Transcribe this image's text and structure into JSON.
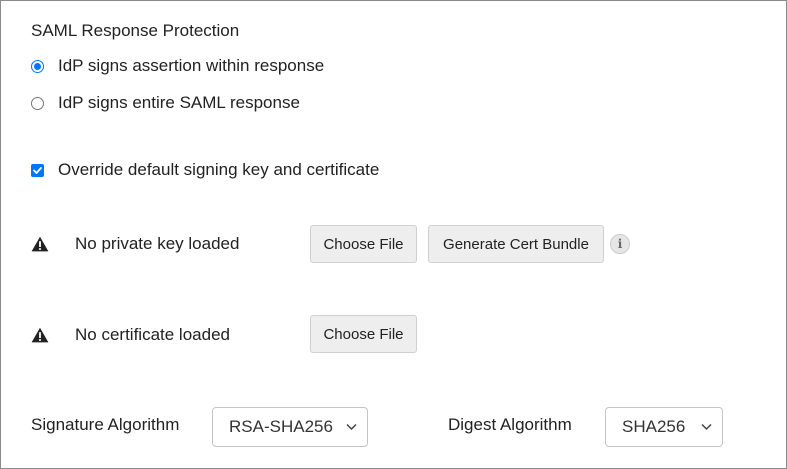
{
  "saml_response_protection": {
    "title": "SAML Response Protection",
    "options": [
      {
        "label": "IdP signs assertion within response",
        "selected": true
      },
      {
        "label": "IdP signs entire SAML response",
        "selected": false
      }
    ]
  },
  "override_signing": {
    "label": "Override default signing key and certificate",
    "checked": true
  },
  "private_key": {
    "status_icon": "warning-icon",
    "status_text": "No private key loaded",
    "choose_file_label": "Choose File",
    "generate_label": "Generate Cert Bundle",
    "info_icon": "i"
  },
  "certificate": {
    "status_icon": "warning-icon",
    "status_text": "No certificate loaded",
    "choose_file_label": "Choose File"
  },
  "signature_algorithm": {
    "label": "Signature Algorithm",
    "selected": "RSA-SHA256"
  },
  "digest_algorithm": {
    "label": "Digest Algorithm",
    "selected": "SHA256"
  },
  "colors": {
    "accent": "#0075ff",
    "button_bg": "#eeeeee",
    "border": "#8a8a8a"
  }
}
